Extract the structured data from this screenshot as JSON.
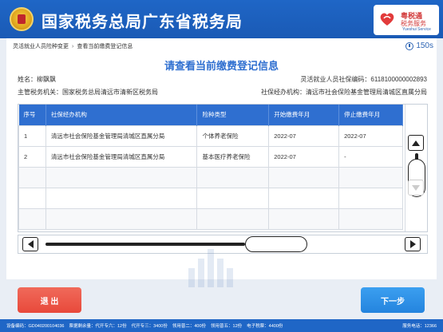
{
  "header": {
    "title": "国家税务总局广东省税务局",
    "service_logo": {
      "line1": "粤税通",
      "line2": "税务服务",
      "line3": "Yueshui Service"
    }
  },
  "breadcrumb": {
    "items": [
      "灵活就业人员险种变更",
      "查看当前缴费登记信息"
    ],
    "separator": "›"
  },
  "timer": {
    "value": "150s"
  },
  "page": {
    "title": "请查看当前缴费登记信息",
    "name_label": "姓名：",
    "name_value": "柳飘飘",
    "si_code_label": "灵活就业人员社保编码：",
    "si_code_value": "6118100000002893",
    "tax_authority_label": "主管税务机关：",
    "tax_authority_value": "国家税务总局清远市清新区税务局",
    "si_agency_label": "社保经办机构：",
    "si_agency_value": "清远市社会保险基金管理局清城区直属分局"
  },
  "table": {
    "headers": [
      "序号",
      "社保经办机构",
      "险种类型",
      "开始缴费年月",
      "停止缴费年月"
    ],
    "rows": [
      [
        "1",
        "清远市社会保险基金管理局清城区直属分局",
        "个体养老保险",
        "2022-07",
        "2022-07"
      ],
      [
        "2",
        "清远市社会保险基金管理局清城区直属分局",
        "基本医疗养老保险",
        "2022-07",
        "-"
      ]
    ]
  },
  "buttons": {
    "exit": "退 出",
    "next": "下一步"
  },
  "status_bar": {
    "device": "设备编码：GD040200104036",
    "t1": "票据剩余量：代开专六：12份",
    "t2": "代开专三：3400份",
    "t3": "领用普二：400份",
    "t4": "领用普五：12份",
    "t5": "电子税票：4400份",
    "phone": "服务电话：12366"
  },
  "colors": {
    "brand_blue": "#1f66c6",
    "accent_blue": "#2f6fd0",
    "exit_red": "#e8493b",
    "next_blue": "#2484de"
  }
}
